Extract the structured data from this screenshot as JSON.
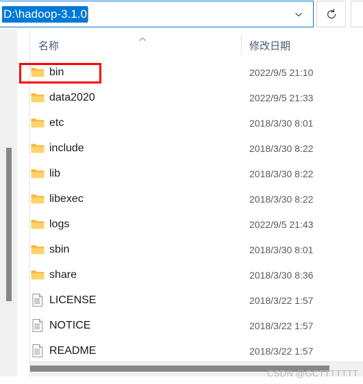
{
  "address_bar": {
    "path_value": "D:\\hadoop-3.1.0",
    "placeholder": "",
    "dropdown_icon": "chevron-down-icon",
    "refresh_icon": "refresh-icon",
    "refresh_label": "刷新"
  },
  "columns": {
    "name_header": "名称",
    "date_header": "修改日期",
    "sort_indicator": "sort-ascending-caret"
  },
  "files": [
    {
      "name": "bin",
      "date": "2022/9/5 21:10",
      "type": "folder",
      "highlighted": true
    },
    {
      "name": "data2020",
      "date": "2022/9/5 21:33",
      "type": "folder",
      "highlighted": false
    },
    {
      "name": "etc",
      "date": "2018/3/30 8:01",
      "type": "folder",
      "highlighted": false
    },
    {
      "name": "include",
      "date": "2018/3/30 8:22",
      "type": "folder",
      "highlighted": false
    },
    {
      "name": "lib",
      "date": "2018/3/30 8:22",
      "type": "folder",
      "highlighted": false
    },
    {
      "name": "libexec",
      "date": "2018/3/30 8:22",
      "type": "folder",
      "highlighted": false
    },
    {
      "name": "logs",
      "date": "2022/9/5 21:43",
      "type": "folder",
      "highlighted": false
    },
    {
      "name": "sbin",
      "date": "2018/3/30 8:01",
      "type": "folder",
      "highlighted": false
    },
    {
      "name": "share",
      "date": "2018/3/30 8:36",
      "type": "folder",
      "highlighted": false
    },
    {
      "name": "LICENSE",
      "date": "2018/3/22 1:57",
      "type": "document",
      "highlighted": false
    },
    {
      "name": "NOTICE",
      "date": "2018/3/22 1:57",
      "type": "document",
      "highlighted": false
    },
    {
      "name": "README",
      "date": "2018/3/22 1:57",
      "type": "document",
      "highlighted": false
    }
  ],
  "annotation": {
    "target": "bin",
    "color": "#ff0000",
    "shape": "rectangle"
  },
  "watermark": {
    "text": "CSDN @GCTTTTTTT"
  },
  "colors": {
    "accent": "#0078d7",
    "selection_bg": "#0078d7",
    "selection_fg": "#ffffff",
    "folder": "#ffc83d",
    "header_text": "#4a5b77",
    "row_text": "#1a1a1a",
    "date_text": "#555a60",
    "scrollbar": "#878787",
    "annotation": "#ff0000"
  }
}
